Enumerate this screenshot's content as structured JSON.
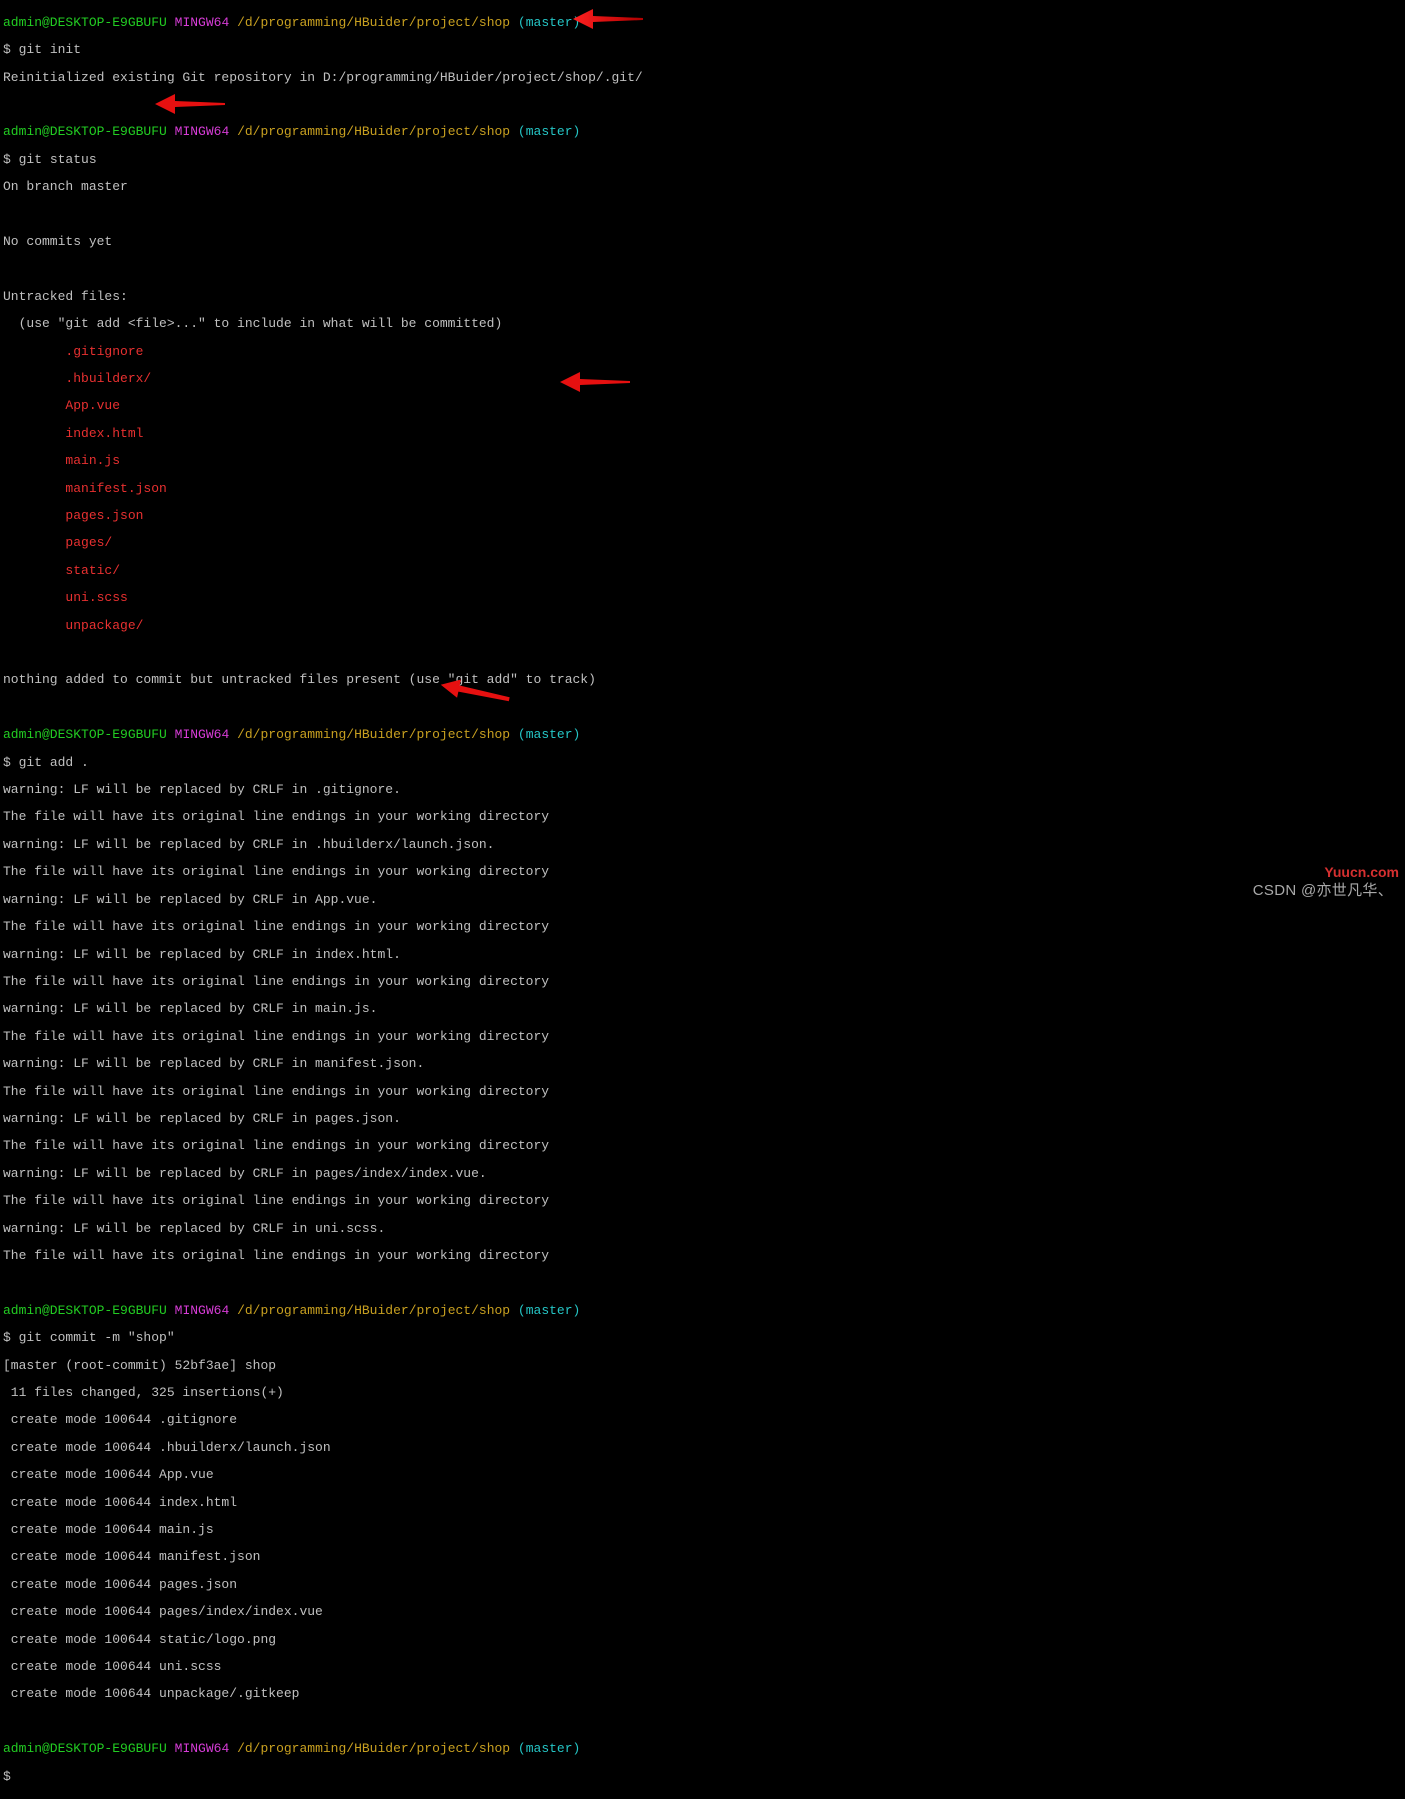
{
  "prompt": {
    "user": "admin@DESKTOP-E9GBUFU",
    "shell": "MINGW64",
    "path": "/d/programming/HBuider/project/shop",
    "branch": "(master)",
    "dollar": "$ "
  },
  "block1": {
    "cmd": "git init",
    "l1": "Reinitialized existing Git repository in D:/programming/HBuider/project/shop/.git/"
  },
  "block2": {
    "cmd": "git status",
    "l1": "On branch master",
    "l2": "No commits yet",
    "l3": "Untracked files:",
    "l4": "  (use \"git add <file>...\" to include in what will be committed)",
    "u0": "        .gitignore",
    "u1": "        .hbuilderx/",
    "u2": "        App.vue",
    "u3": "        index.html",
    "u4": "        main.js",
    "u5": "        manifest.json",
    "u6": "        pages.json",
    "u7": "        pages/",
    "u8": "        static/",
    "u9": "        uni.scss",
    "u10": "        unpackage/",
    "l5": "nothing added to commit but untracked files present (use \"git add\" to track)"
  },
  "block3": {
    "cmd": "git add .",
    "l0": "warning: LF will be replaced by CRLF in .gitignore.",
    "l1": "The file will have its original line endings in your working directory",
    "l2": "warning: LF will be replaced by CRLF in .hbuilderx/launch.json.",
    "l3": "The file will have its original line endings in your working directory",
    "l4": "warning: LF will be replaced by CRLF in App.vue.",
    "l5": "The file will have its original line endings in your working directory",
    "l6": "warning: LF will be replaced by CRLF in index.html.",
    "l7": "The file will have its original line endings in your working directory",
    "l8": "warning: LF will be replaced by CRLF in main.js.",
    "l9": "The file will have its original line endings in your working directory",
    "l10": "warning: LF will be replaced by CRLF in manifest.json.",
    "l11": "The file will have its original line endings in your working directory",
    "l12": "warning: LF will be replaced by CRLF in pages.json.",
    "l13": "The file will have its original line endings in your working directory",
    "l14": "warning: LF will be replaced by CRLF in pages/index/index.vue.",
    "l15": "The file will have its original line endings in your working directory",
    "l16": "warning: LF will be replaced by CRLF in uni.scss.",
    "l17": "The file will have its original line endings in your working directory"
  },
  "block4": {
    "cmd": "git commit -m \"shop\"",
    "l0": "[master (root-commit) 52bf3ae] shop",
    "l1": " 11 files changed, 325 insertions(+)",
    "l2": " create mode 100644 .gitignore",
    "l3": " create mode 100644 .hbuilderx/launch.json",
    "l4": " create mode 100644 App.vue",
    "l5": " create mode 100644 index.html",
    "l6": " create mode 100644 main.js",
    "l7": " create mode 100644 manifest.json",
    "l8": " create mode 100644 pages.json",
    "l9": " create mode 100644 pages/index/index.vue",
    "l10": " create mode 100644 static/logo.png",
    "l11": " create mode 100644 uni.scss",
    "l12": " create mode 100644 unpackage/.gitkeep"
  },
  "watermark1": "CSDN @亦世凡华、",
  "watermark2": "Yuucn.com"
}
